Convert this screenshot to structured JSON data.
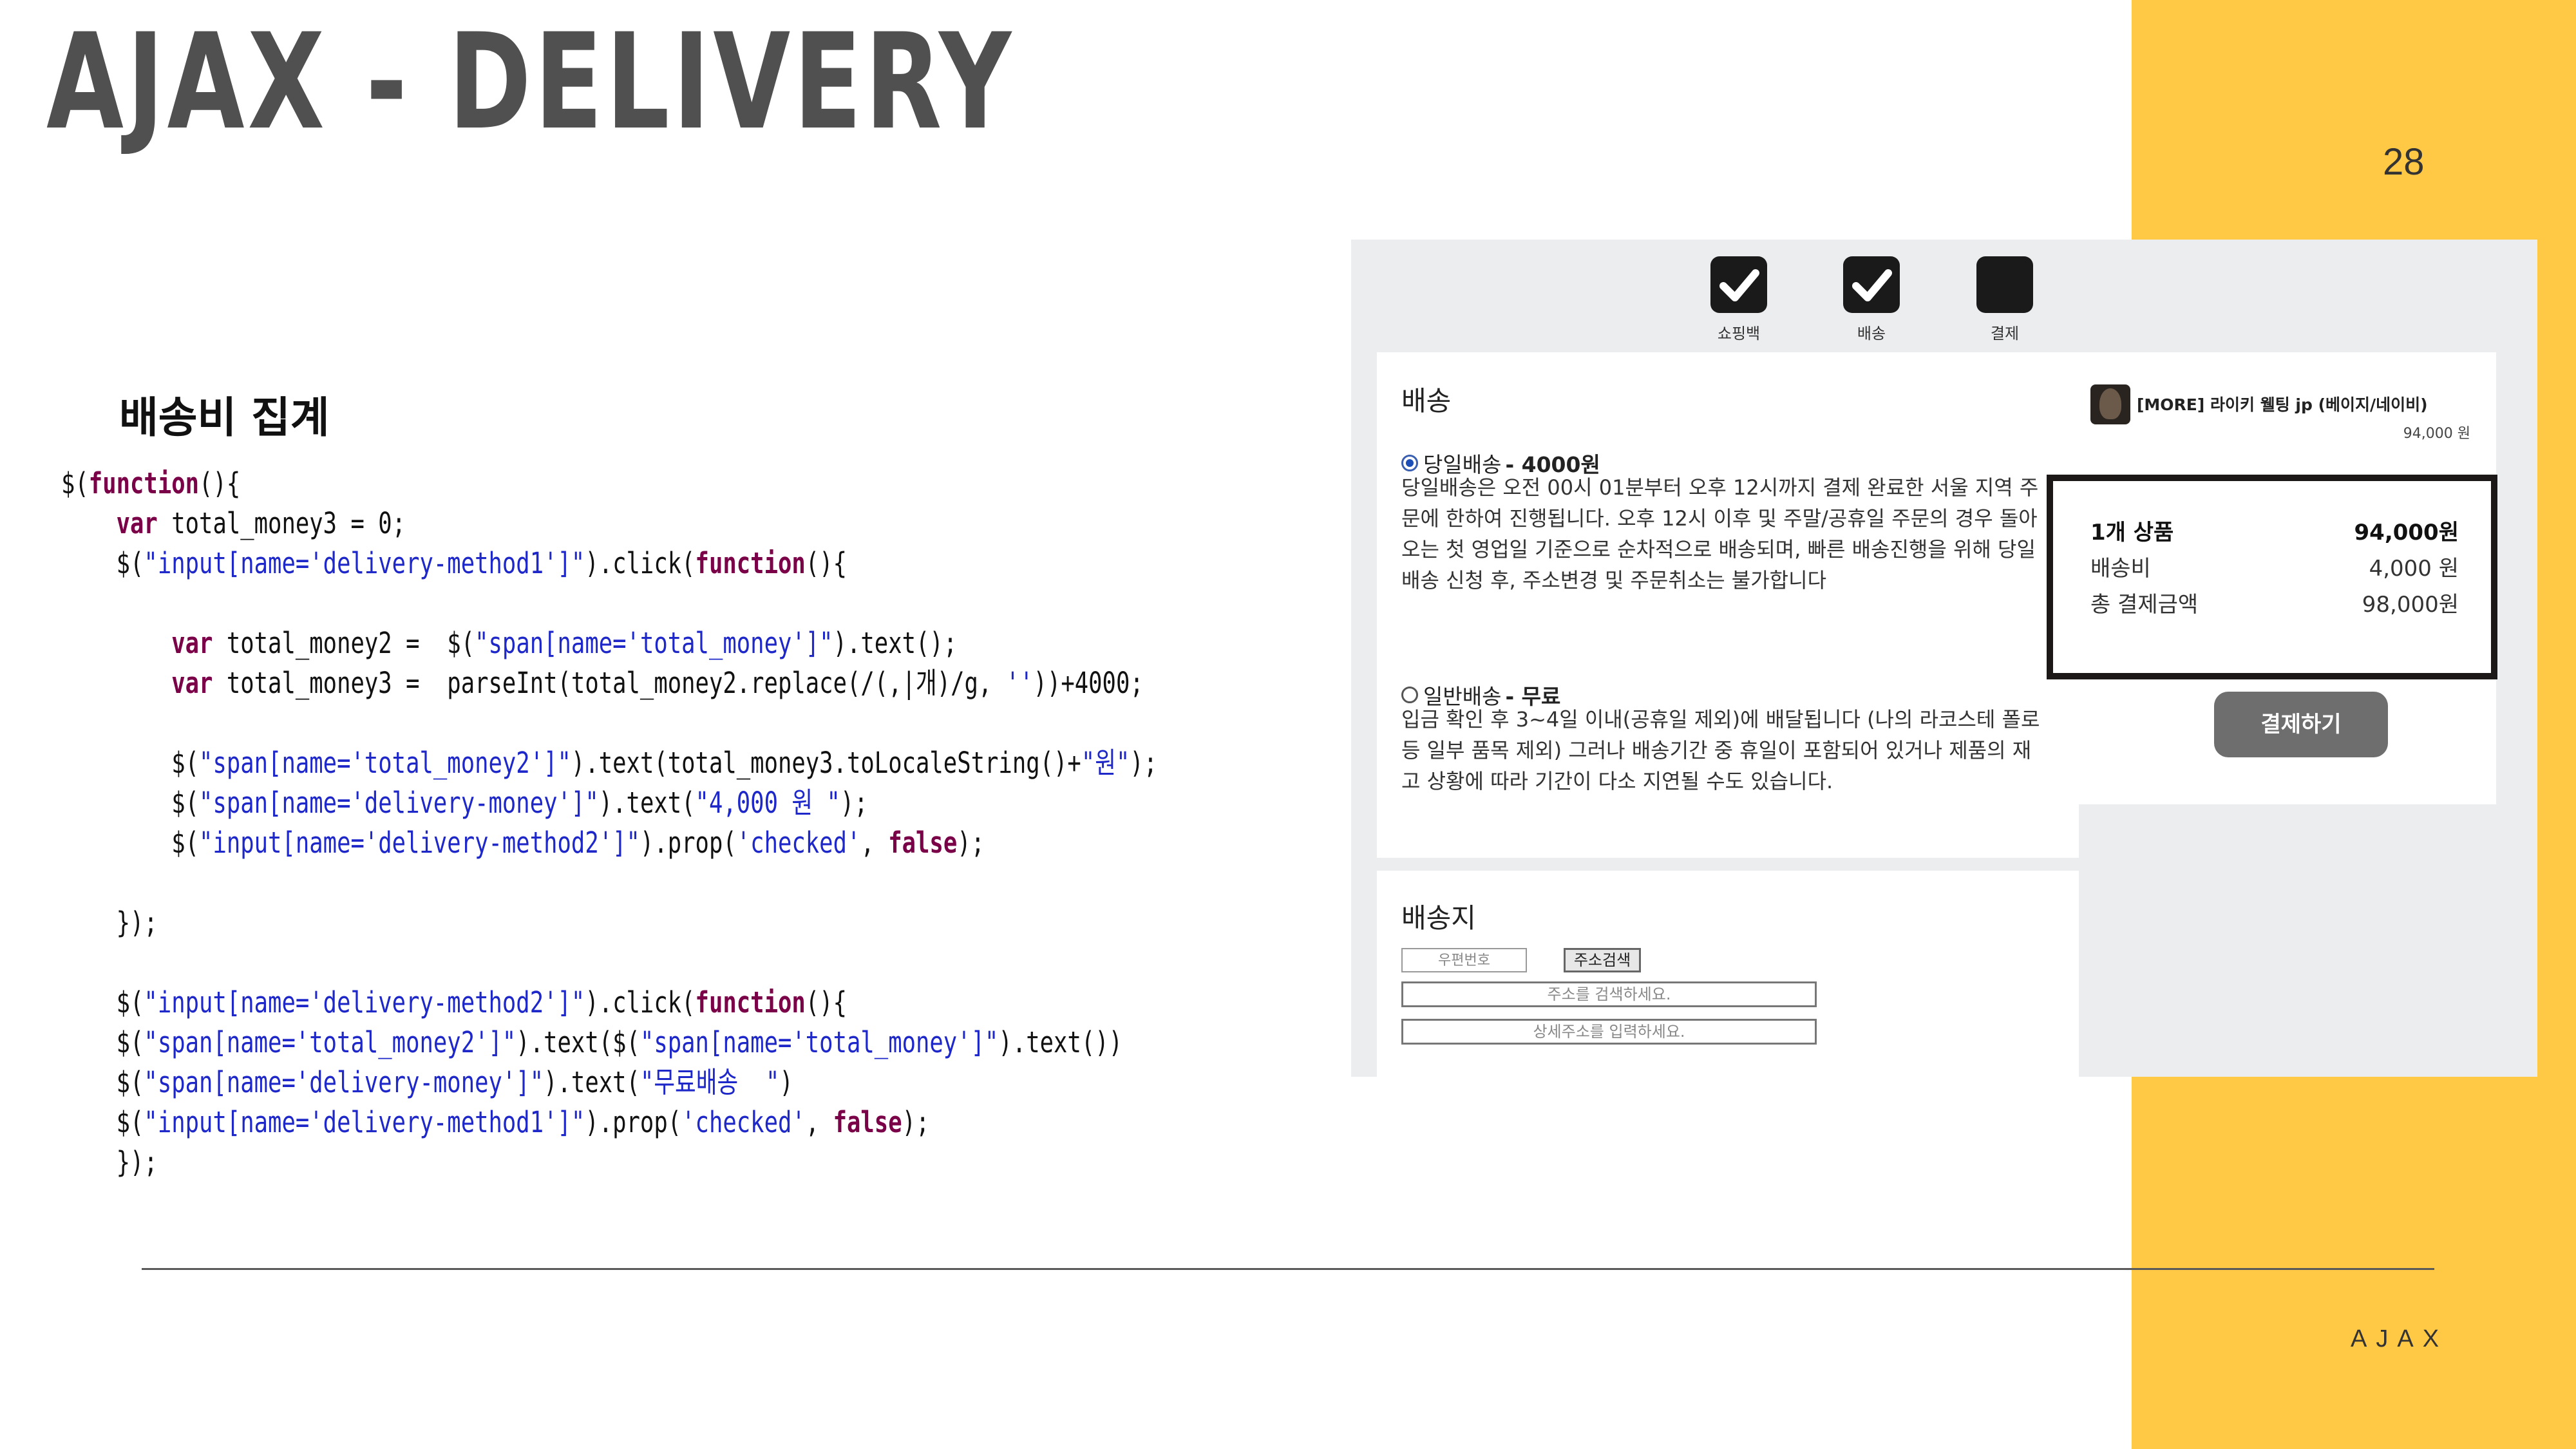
{
  "slide": {
    "title": "AJAX - DELIVERY",
    "page_number": "28",
    "footer_label": "AJAX",
    "section_heading": "배송비 집계"
  },
  "code": [
    [
      [
        "t",
        "$("
      ],
      [
        "k",
        "function"
      ],
      [
        "t",
        "(){"
      ]
    ],
    [
      [
        "t",
        "    "
      ],
      [
        "k",
        "var"
      ],
      [
        "t",
        " total_money3 = 0;"
      ]
    ],
    [
      [
        "t",
        "    $("
      ],
      [
        "s",
        "\"input[name='delivery-method1']\""
      ],
      [
        "t",
        ").click("
      ],
      [
        "k",
        "function"
      ],
      [
        "t",
        "(){"
      ]
    ],
    [],
    [
      [
        "t",
        "        "
      ],
      [
        "k",
        "var"
      ],
      [
        "t",
        " total_money2 =  $("
      ],
      [
        "s",
        "\"span[name='total_money']\""
      ],
      [
        "t",
        ").text();"
      ]
    ],
    [
      [
        "t",
        "        "
      ],
      [
        "k",
        "var"
      ],
      [
        "t",
        " total_money3 =  parseInt(total_money2.replace(/(,|개)/g, "
      ],
      [
        "s",
        "''"
      ],
      [
        "t",
        "))+4000;"
      ]
    ],
    [],
    [
      [
        "t",
        "        $("
      ],
      [
        "s",
        "\"span[name='total_money2']\""
      ],
      [
        "t",
        ").text(total_money3.toLocaleString()+"
      ],
      [
        "s",
        "\"원\""
      ],
      [
        "t",
        ");"
      ]
    ],
    [
      [
        "t",
        "        $("
      ],
      [
        "s",
        "\"span[name='delivery-money']\""
      ],
      [
        "t",
        ").text("
      ],
      [
        "s",
        "\"4,000 원 \""
      ],
      [
        "t",
        ");"
      ]
    ],
    [
      [
        "t",
        "        $("
      ],
      [
        "s",
        "\"input[name='delivery-method2']\""
      ],
      [
        "t",
        ").prop("
      ],
      [
        "s",
        "'checked'"
      ],
      [
        "t",
        ", "
      ],
      [
        "k",
        "false"
      ],
      [
        "t",
        ");"
      ]
    ],
    [],
    [
      [
        "t",
        "    });"
      ]
    ],
    [],
    [
      [
        "t",
        "    $("
      ],
      [
        "s",
        "\"input[name='delivery-method2']\""
      ],
      [
        "t",
        ").click("
      ],
      [
        "k",
        "function"
      ],
      [
        "t",
        "(){"
      ]
    ],
    [
      [
        "t",
        "    $("
      ],
      [
        "s",
        "\"span[name='total_money2']\""
      ],
      [
        "t",
        ").text($("
      ],
      [
        "s",
        "\"span[name='total_money']\""
      ],
      [
        "t",
        ").text())"
      ]
    ],
    [
      [
        "t",
        "    $("
      ],
      [
        "s",
        "\"span[name='delivery-money']\""
      ],
      [
        "t",
        ").text("
      ],
      [
        "s",
        "\"무료배송  \""
      ],
      [
        "t",
        ")"
      ]
    ],
    [
      [
        "t",
        "    $("
      ],
      [
        "s",
        "\"input[name='delivery-method1']\""
      ],
      [
        "t",
        ").prop("
      ],
      [
        "s",
        "'checked'"
      ],
      [
        "t",
        ", "
      ],
      [
        "k",
        "false"
      ],
      [
        "t",
        ");"
      ]
    ],
    [
      [
        "t",
        "    });"
      ]
    ]
  ],
  "shop": {
    "steps": [
      {
        "label": "쇼핑백",
        "checked": true
      },
      {
        "label": "배송",
        "checked": true
      },
      {
        "label": "결제",
        "checked": false
      }
    ],
    "delivery": {
      "heading": "배송",
      "option1": {
        "label": "당일배송",
        "price": "- 4000원",
        "selected": true,
        "description": "당일배송은 오전 00시 01분부터 오후 12시까지 결제 완료한 서울 지역 주문에 한하여 진행됩니다. 오후 12시 이후 및 주말/공휴일 주문의 경우 돌아오는 첫 영업일 기준으로 순차적으로 배송되며, 빠른 배송진행을 위해 당일배송 신청 후, 주소변경 및 주문취소는 불가합니다"
      },
      "option2": {
        "label": "일반배송",
        "price": "- 무료",
        "selected": false,
        "description": "입금 확인 후 3~4일 이내(공휴일 제외)에 배달됩니다 (나의 라코스테 폴로 등 일부 품목 제외) 그러나 배송기간 중 휴일이 포함되어 있거나 제품의 재고 상황에 따라 기간이 다소 지연될 수도 있습니다."
      }
    },
    "address": {
      "heading": "배송지",
      "postcode_placeholder": "우편번호",
      "search_button": "주소검색",
      "address_placeholder": "주소를 검색하세요.",
      "detail_placeholder": "상세주소를 입력하세요."
    },
    "product": {
      "name": "[MORE] 라이키 웰팅 jp (베이지/네이비)",
      "price": "94,000 원"
    },
    "summary": {
      "items_label": "1개 상품",
      "items_value": "94,000원",
      "shipping_label": "배송비",
      "shipping_value": "4,000 원",
      "total_label": "총 결제금액",
      "total_value": "98,000원"
    },
    "pay_button": "결제하기"
  },
  "colors": {
    "accent_yellow": "#ffc845",
    "title_gray": "#505050",
    "code_keyword": "#7a0048",
    "code_string": "#1e28c8",
    "radio_selected": "#1b4eb6"
  }
}
